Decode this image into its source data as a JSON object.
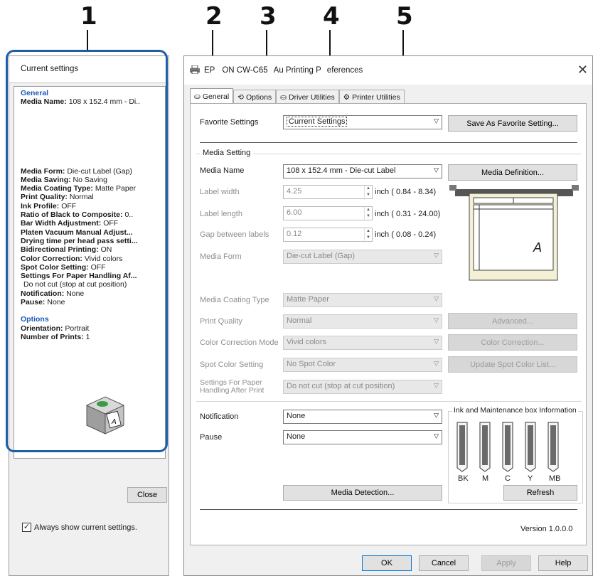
{
  "callouts": [
    "1",
    "2",
    "3",
    "4",
    "5"
  ],
  "left_panel": {
    "title": "Current settings",
    "general_header": "General",
    "general_items": [
      {
        "label": "Media Name:",
        "value": "108 x 152.4 mm - Di.."
      },
      {
        "label": "Media Form:",
        "value": "Die-cut Label (Gap)"
      },
      {
        "label": "Media Saving:",
        "value": "No Saving"
      },
      {
        "label": "Media Coating Type:",
        "value": "Matte Paper"
      },
      {
        "label": "Print Quality:",
        "value": "Normal"
      },
      {
        "label": "Ink Profile:",
        "value": "OFF"
      },
      {
        "label": "Ratio of Black to Composite:",
        "value": "0.."
      },
      {
        "label": "Bar Width Adjustment:",
        "value": "OFF"
      },
      {
        "label": "Platen Vacuum Manual Adjust...",
        "value": ""
      },
      {
        "label": "Drying time per head pass setti...",
        "value": ""
      },
      {
        "label": "Bidirectional Printing:",
        "value": "ON"
      },
      {
        "label": "Color Correction:",
        "value": "Vivid colors"
      },
      {
        "label": "Spot Color Setting:",
        "value": "OFF"
      },
      {
        "label": "Settings For Paper Handling Af...",
        "value": ""
      },
      {
        "label": "",
        "value": "Do not cut (stop at cut position)"
      },
      {
        "label": "Notification:",
        "value": "None"
      },
      {
        "label": "Pause:",
        "value": "None"
      }
    ],
    "options_header": "Options",
    "options_items": [
      {
        "label": "Orientation:",
        "value": "Portrait"
      },
      {
        "label": "Number of Prints:",
        "value": "1"
      }
    ],
    "always_show_label": "Always show current settings.",
    "close_label": "Close"
  },
  "dialog": {
    "title_left": "EP",
    "title_mid": "ON CW-C65",
    "title_mid2": "Au Printing P",
    "title_right": "eferences",
    "tabs": [
      "General",
      "Options",
      "Driver Utilities",
      "Printer Utilities"
    ],
    "favorite": {
      "label": "Favorite Settings",
      "value": "Current Settings",
      "save_button": "Save As Favorite Setting..."
    },
    "media_setting_title": "Media Setting",
    "media_name": {
      "label": "Media Name",
      "value": "108 x 152.4 mm - Die-cut Label",
      "button": "Media Definition..."
    },
    "label_width": {
      "label": "Label width",
      "value": "4.25",
      "unit": "inch ( 0.84 -  8.34)"
    },
    "label_length": {
      "label": "Label length",
      "value": "6.00",
      "unit": "inch ( 0.31 - 24.00)"
    },
    "gap": {
      "label": "Gap between labels",
      "value": "0.12",
      "unit": "inch ( 0.08 -  0.24)"
    },
    "media_form": {
      "label": "Media Form",
      "value": "Die-cut Label (Gap)"
    },
    "coating": {
      "label": "Media Coating Type",
      "value": "Matte Paper"
    },
    "quality": {
      "label": "Print Quality",
      "value": "Normal",
      "button": "Advanced..."
    },
    "color_mode": {
      "label": "Color Correction Mode",
      "value": "Vivid colors",
      "button": "Color Correction..."
    },
    "spot": {
      "label": "Spot Color Setting",
      "value": "No Spot Color",
      "button": "Update Spot Color List..."
    },
    "after_print": {
      "label1": "Settings For Paper",
      "label2": "Handling After Print",
      "value": "Do not cut (stop at cut position)"
    },
    "notification": {
      "label": "Notification",
      "value": "None"
    },
    "pause": {
      "label": "Pause",
      "value": "None"
    },
    "ink_box": {
      "title": "Ink and Maintenance box Information",
      "cartridges": [
        "BK",
        "M",
        "C",
        "Y",
        "MB"
      ],
      "refresh": "Refresh"
    },
    "media_detection": "Media Detection...",
    "version": "Version 1.0.0.0",
    "buttons": {
      "ok": "OK",
      "cancel": "Cancel",
      "apply": "Apply",
      "help": "Help"
    },
    "preview_glyph": "A"
  }
}
